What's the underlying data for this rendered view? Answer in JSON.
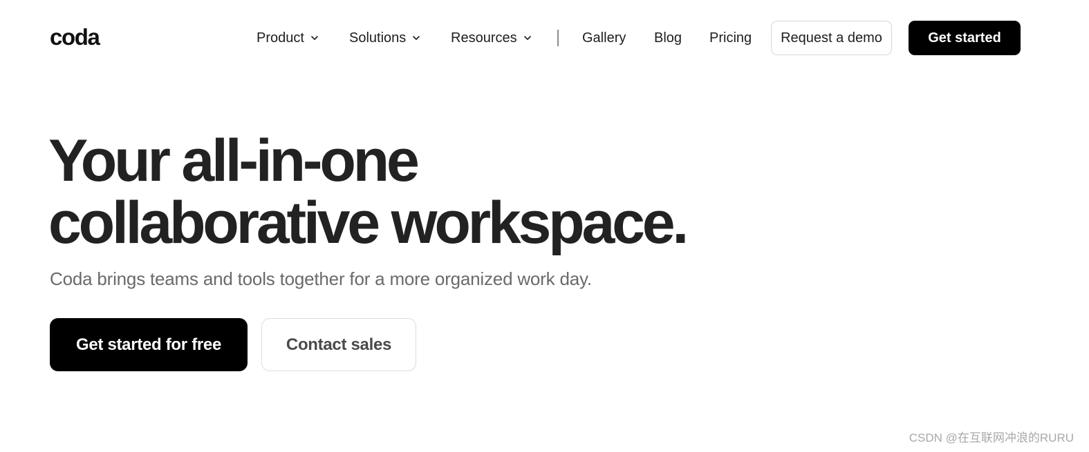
{
  "header": {
    "logo": "coda",
    "nav": [
      {
        "label": "Product",
        "has_dropdown": true
      },
      {
        "label": "Solutions",
        "has_dropdown": true
      },
      {
        "label": "Resources",
        "has_dropdown": true
      },
      {
        "label": "Gallery",
        "has_dropdown": false
      },
      {
        "label": "Blog",
        "has_dropdown": false
      },
      {
        "label": "Pricing",
        "has_dropdown": false
      }
    ],
    "request_demo_label": "Request a demo",
    "get_started_label": "Get started",
    "dropdown_icon": "chevron-down-icon"
  },
  "hero": {
    "headline_line1": "Your all-in-one",
    "headline_line2": "collaborative workspace.",
    "subheadline": "Coda brings teams and tools together for a more organized work day.",
    "primary_cta": "Get started for free",
    "secondary_cta": "Contact sales"
  },
  "watermark": "CSDN @在互联网冲浪的RURU",
  "colors": {
    "background": "#ffffff",
    "text": "#1d1d1d",
    "headline": "#222222",
    "subtext": "#6a6a6a",
    "primary_button": "#000000",
    "border": "#d6d6d6"
  }
}
